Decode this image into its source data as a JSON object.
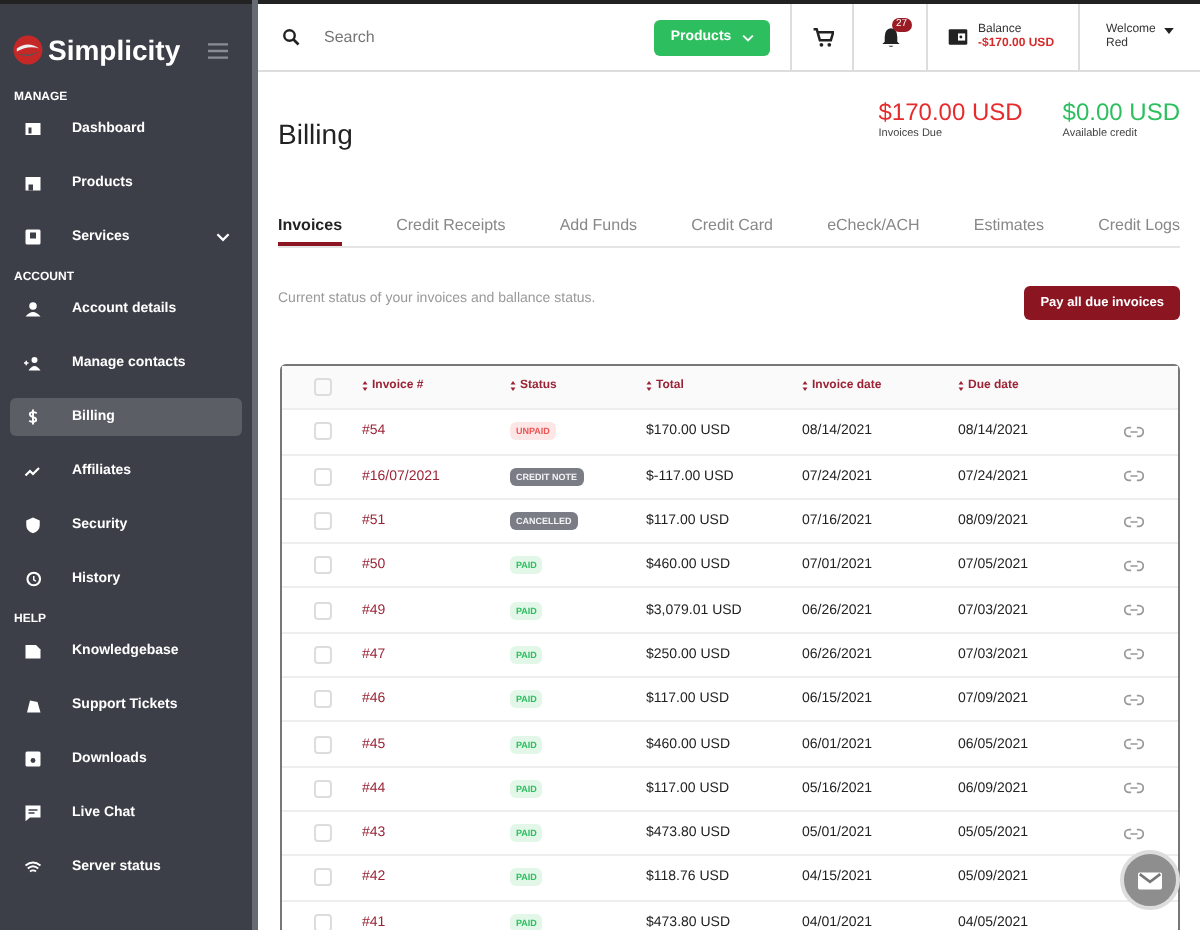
{
  "brand": "Simplicity",
  "sidebar": {
    "sections": [
      {
        "title": "MANAGE",
        "items": [
          {
            "label": "Dashboard",
            "kind": "link",
            "selected": false
          },
          {
            "label": "Products",
            "kind": "link",
            "selected": false
          },
          {
            "label": "Services",
            "kind": "submenu",
            "selected": false
          }
        ]
      },
      {
        "title": "ACCOUNT",
        "items": [
          {
            "label": "Account details",
            "kind": "link",
            "selected": false
          },
          {
            "label": "Manage contacts",
            "kind": "link",
            "selected": false
          },
          {
            "label": "Billing",
            "kind": "link",
            "selected": true
          },
          {
            "label": "Affiliates",
            "kind": "link",
            "selected": false
          },
          {
            "label": "Security",
            "kind": "link",
            "selected": false
          },
          {
            "label": "History",
            "kind": "link",
            "selected": false
          }
        ]
      },
      {
        "title": "HELP",
        "items": [
          {
            "label": "Knowledgebase",
            "kind": "link",
            "selected": false
          },
          {
            "label": "Support Tickets",
            "kind": "link",
            "selected": false
          },
          {
            "label": "Downloads",
            "kind": "link",
            "selected": false
          },
          {
            "label": "Live Chat",
            "kind": "link",
            "selected": false
          },
          {
            "label": "Server status",
            "kind": "link",
            "selected": false
          }
        ]
      }
    ]
  },
  "topbar": {
    "search": {
      "placeholder": "Search"
    },
    "products_button": "Products",
    "notifications": "27",
    "balance": {
      "label": "Balance",
      "value": "-$170.00 USD"
    },
    "user": {
      "greeting": "Welcome",
      "name": "Red"
    }
  },
  "page": {
    "title": "Billing",
    "invoices_due": {
      "amount": "$170.00 USD",
      "label": "Invoices Due"
    },
    "available_credit": {
      "amount": "$0.00 USD",
      "label": "Available credit"
    }
  },
  "tabs": [
    {
      "label": "Invoices",
      "selected": true
    },
    {
      "label": "Credit Receipts",
      "selected": false
    },
    {
      "label": "Add Funds",
      "selected": false
    },
    {
      "label": "Credit Card",
      "selected": false
    },
    {
      "label": "eCheck/ACH",
      "selected": false
    },
    {
      "label": "Estimates",
      "selected": false
    },
    {
      "label": "Credit Logs",
      "selected": false
    }
  ],
  "description": "Current status of your invoices and ballance status.",
  "pay_button": "Pay all due invoices",
  "table": {
    "header_checked": false,
    "columns": [
      "Invoice #",
      "Status",
      "Total",
      "Invoice date",
      "Due date"
    ],
    "rows": [
      {
        "checked": false,
        "invoice": "#54",
        "status": "UNPAID",
        "kind": "unpaid",
        "total": "$170.00 USD",
        "invoice_date": "08/14/2021",
        "due_date": "08/14/2021"
      },
      {
        "checked": false,
        "invoice": "#16/07/2021",
        "status": "CREDIT NOTE",
        "kind": "grey",
        "total": "$-117.00 USD",
        "invoice_date": "07/24/2021",
        "due_date": "07/24/2021"
      },
      {
        "checked": false,
        "invoice": "#51",
        "status": "CANCELLED",
        "kind": "grey",
        "total": "$117.00 USD",
        "invoice_date": "07/16/2021",
        "due_date": "08/09/2021"
      },
      {
        "checked": false,
        "invoice": "#50",
        "status": "PAID",
        "kind": "paid",
        "total": "$460.00 USD",
        "invoice_date": "07/01/2021",
        "due_date": "07/05/2021"
      },
      {
        "checked": false,
        "invoice": "#49",
        "status": "PAID",
        "kind": "paid",
        "total": "$3,079.01 USD",
        "invoice_date": "06/26/2021",
        "due_date": "07/03/2021"
      },
      {
        "checked": false,
        "invoice": "#47",
        "status": "PAID",
        "kind": "paid",
        "total": "$250.00 USD",
        "invoice_date": "06/26/2021",
        "due_date": "07/03/2021"
      },
      {
        "checked": false,
        "invoice": "#46",
        "status": "PAID",
        "kind": "paid",
        "total": "$117.00 USD",
        "invoice_date": "06/15/2021",
        "due_date": "07/09/2021"
      },
      {
        "checked": false,
        "invoice": "#45",
        "status": "PAID",
        "kind": "paid",
        "total": "$460.00 USD",
        "invoice_date": "06/01/2021",
        "due_date": "06/05/2021"
      },
      {
        "checked": false,
        "invoice": "#44",
        "status": "PAID",
        "kind": "paid",
        "total": "$117.00 USD",
        "invoice_date": "05/16/2021",
        "due_date": "06/09/2021"
      },
      {
        "checked": false,
        "invoice": "#43",
        "status": "PAID",
        "kind": "paid",
        "total": "$473.80 USD",
        "invoice_date": "05/01/2021",
        "due_date": "05/05/2021"
      },
      {
        "checked": false,
        "invoice": "#42",
        "status": "PAID",
        "kind": "paid",
        "total": "$118.76 USD",
        "invoice_date": "04/15/2021",
        "due_date": "05/09/2021"
      },
      {
        "checked": false,
        "invoice": "#41",
        "status": "PAID",
        "kind": "paid",
        "total": "$473.80 USD",
        "invoice_date": "04/01/2021",
        "due_date": "04/05/2021"
      }
    ]
  }
}
